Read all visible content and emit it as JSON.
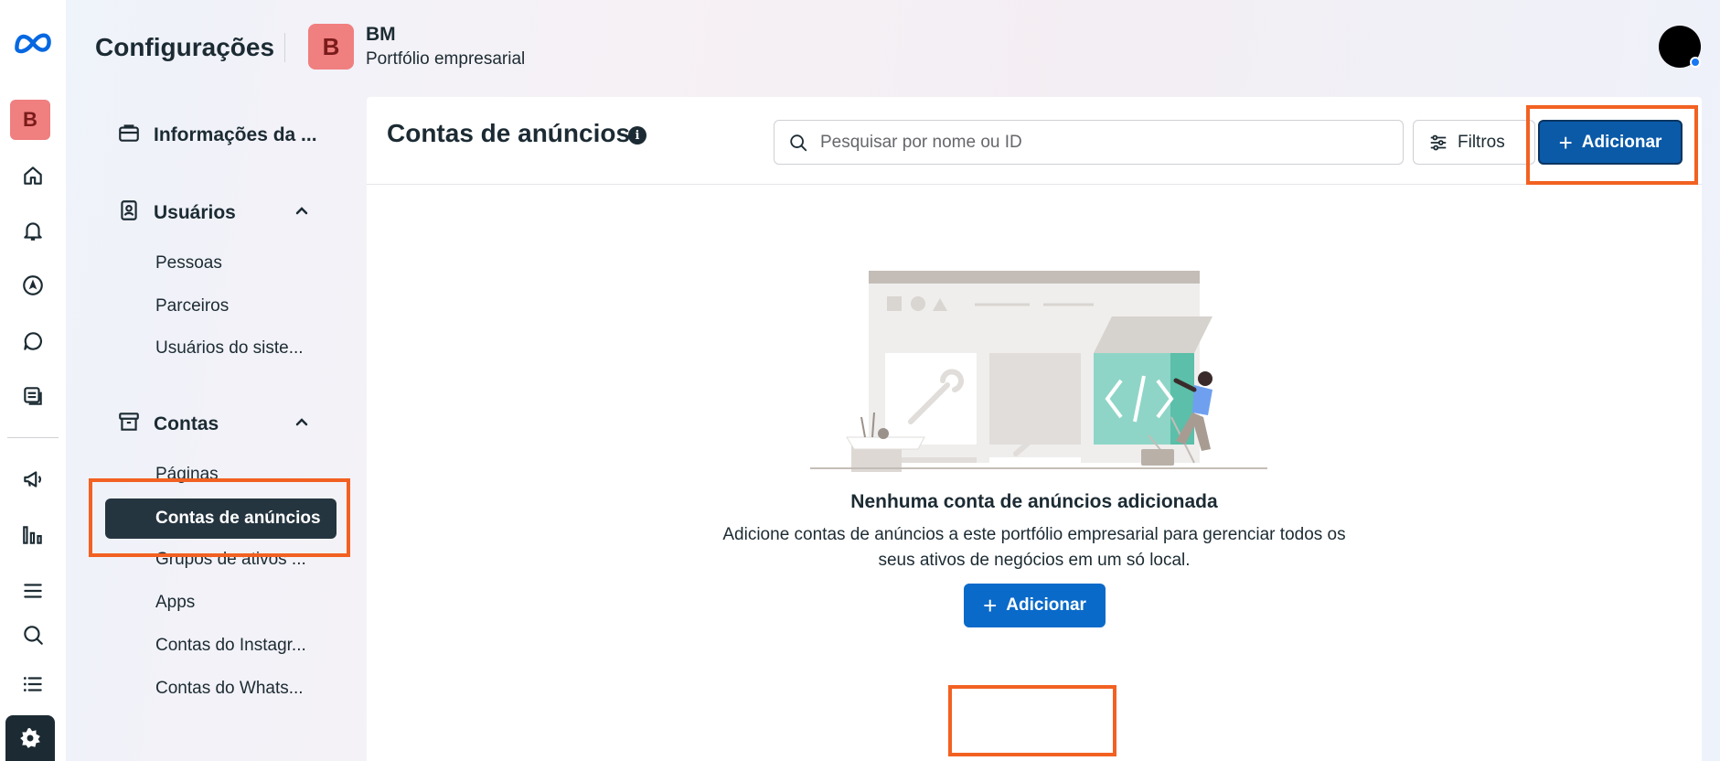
{
  "header": {
    "title": "Configurações",
    "business_initial": "B",
    "business_name": "BM",
    "business_type": "Portfólio empresarial"
  },
  "rail": {
    "avatar_initial": "B",
    "icons": [
      "meta-logo-icon",
      "home-icon",
      "bell-icon",
      "compass-icon",
      "chat-icon",
      "pages-icon",
      "megaphone-icon",
      "analytics-icon",
      "menu-icon",
      "search-icon",
      "list-icon",
      "gear-icon"
    ]
  },
  "nav": {
    "business_info": "Informações da ...",
    "users_section": "Usuários",
    "users_items": [
      "Pessoas",
      "Parceiros",
      "Usuários do siste..."
    ],
    "accounts_section": "Contas",
    "accounts_items": [
      "Páginas",
      "Contas de anúncios",
      "Grupos de ativos ...",
      "Apps",
      "Contas do Instagr...",
      "Contas do Whats..."
    ]
  },
  "main": {
    "title": "Contas de anúncios",
    "search_placeholder": "Pesquisar por nome ou ID",
    "filters_label": "Filtros",
    "add_label": "Adicionar",
    "empty_title": "Nenhuma conta de anúncios adicionada",
    "empty_description": "Adicione contas de anúncios a este portfólio empresarial para gerenciar todos os seus ativos de negócios em um só local.",
    "empty_add_label": "Adicionar"
  },
  "colors": {
    "primary_button": "#0a5aa8",
    "highlight": "#f26122",
    "active_nav": "#253540",
    "avatar": "#f07f7f"
  }
}
